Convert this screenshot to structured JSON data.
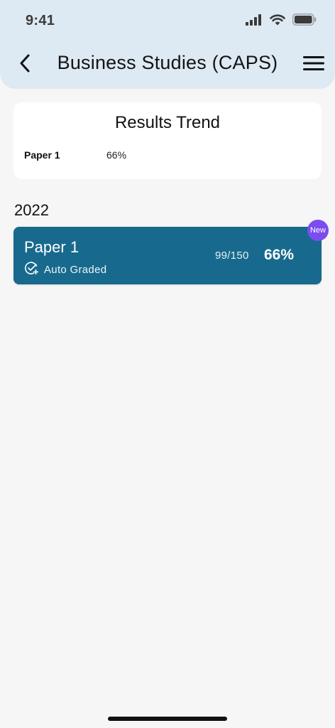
{
  "status_bar": {
    "time": "9:41",
    "icons": [
      "cellular-signal-icon",
      "wifi-icon",
      "battery-icon"
    ]
  },
  "nav": {
    "back_icon": "chevron-left-icon",
    "title": "Business Studies (CAPS)",
    "menu_icon": "hamburger-menu-icon"
  },
  "results_trend": {
    "title": "Results Trend",
    "rows": [
      {
        "label": "Paper 1",
        "value": "66%"
      }
    ]
  },
  "sections": [
    {
      "year": "2022",
      "results": [
        {
          "title": "Paper 1",
          "status_icon": "auto-graded-check-icon",
          "status": "Auto Graded",
          "score": "99/150",
          "percent": "66%",
          "badge": "New"
        }
      ]
    }
  ],
  "colors": {
    "header_bg": "#dde9f3",
    "page_bg": "#f6f6f6",
    "card_accent": "#176a8d",
    "badge": "#7b4cf0"
  }
}
